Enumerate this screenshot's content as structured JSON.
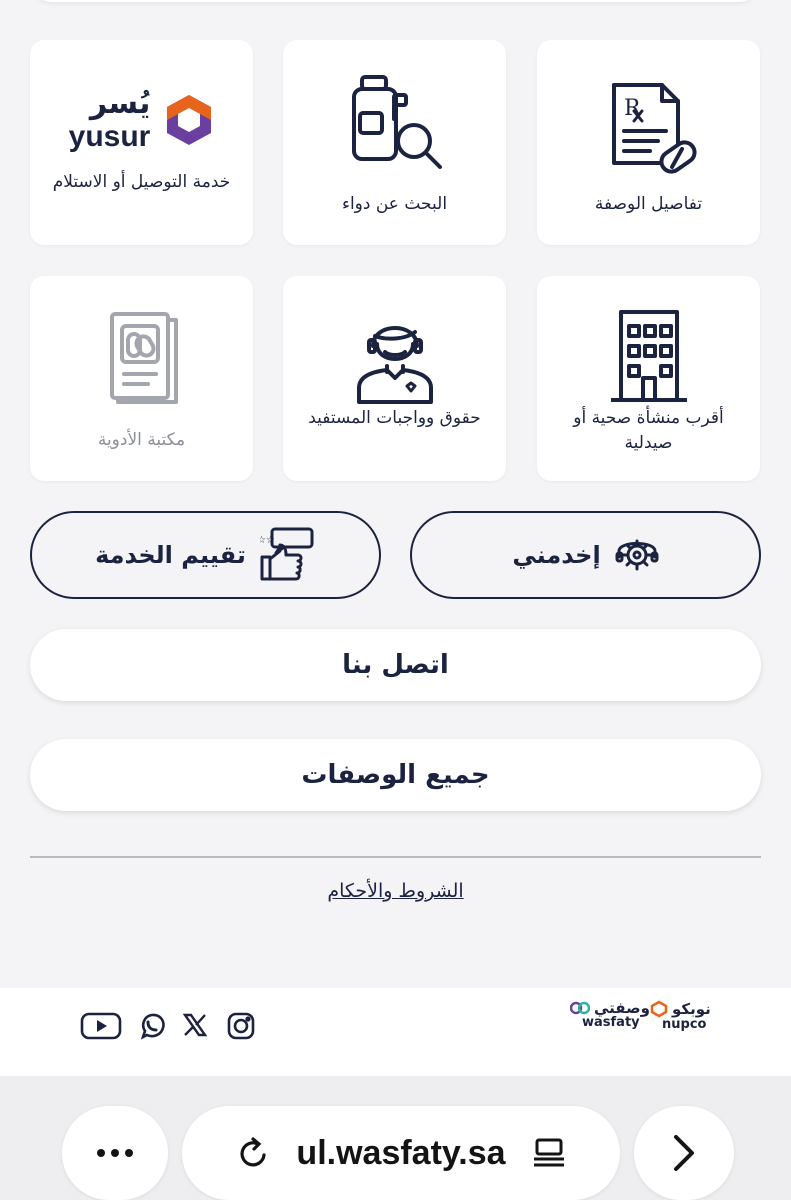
{
  "tiles": [
    {
      "label": "تفاصيل الوصفة",
      "icon": "prescription-icon"
    },
    {
      "label": "البحث عن دواء",
      "icon": "medicine-search-icon"
    },
    {
      "label": "خدمة التوصيل أو الاستلام",
      "icon": "yusur-logo",
      "logo_ar": "يُسر",
      "logo_en": "yusur"
    },
    {
      "label": "أقرب منشأة صحية أو صيدلية",
      "icon": "building-icon"
    },
    {
      "label": "حقوق وواجبات المستفيد",
      "icon": "beneficiary-icon"
    },
    {
      "label": "مكتبة الأدوية",
      "icon": "medicine-library-icon"
    }
  ],
  "actions": {
    "serve_me": "إخدمني",
    "rate_service": "تقييم الخدمة",
    "contact_us": "اتصل بنا",
    "all_prescriptions": "جميع الوصفات"
  },
  "terms_link": "الشروط والأحكام",
  "footer": {
    "social": [
      "instagram-icon",
      "x-icon",
      "whatsapp-icon",
      "youtube-icon"
    ],
    "nupco_ar": "نوبكو",
    "nupco_en": "nupco",
    "wasfaty_ar": "وصفتي",
    "wasfaty_en": "wasfaty"
  },
  "browser": {
    "url": "ul.wasfaty.sa"
  },
  "colors": {
    "navy": "#1b2340",
    "yusur_orange": "#e8631c",
    "yusur_purple": "#6b3fa0",
    "muted": "#8d8f98"
  }
}
